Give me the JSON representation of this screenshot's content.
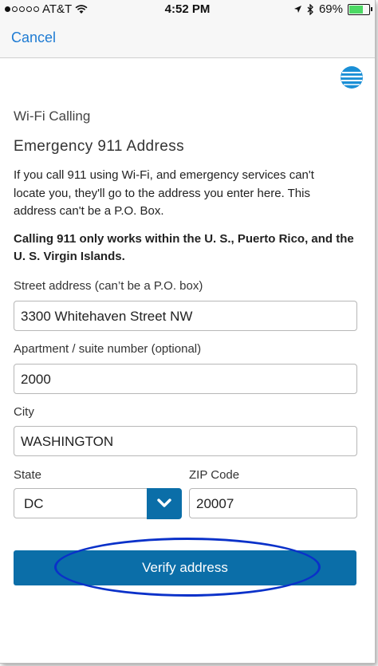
{
  "status": {
    "carrier": "AT&T",
    "time": "4:52 PM",
    "battery": "69%",
    "battery_level": 0.69,
    "signal_bars_filled": 1,
    "signal_bars_total": 5
  },
  "nav": {
    "cancel_label": "Cancel"
  },
  "header": {
    "section": "Wi-Fi Calling",
    "title": "Emergency 911 Address"
  },
  "description": "If you call 911 using Wi-Fi, and emergency services can't locate you, they'll go to the address you enter here. This address can't be a P.O. Box.",
  "notice": "Calling 911 only works within the U. S., Puerto Rico, and the U. S. Virgin Islands.",
  "form": {
    "street_label": "Street address (can’t be a P.O. box)",
    "street_value": "3300 Whitehaven Street NW",
    "apt_label": "Apartment / suite number (optional)",
    "apt_value": "2000",
    "city_label": "City",
    "city_value": "WASHINGTON",
    "state_label": "State",
    "state_value": "DC",
    "zip_label": "ZIP Code",
    "zip_value": "20007"
  },
  "verify_label": "Verify address",
  "colors": {
    "accent": "#0b6ea8",
    "link": "#1e7bd3",
    "annotation_ring": "#0a31c9",
    "battery_fill": "#4cd964"
  },
  "icons": {
    "wifi": "wifi-icon",
    "location": "location-arrow-icon",
    "bluetooth": "bluetooth-icon",
    "battery": "battery-icon",
    "logo": "att-globe-logo",
    "dropdown": "chevron-down-icon"
  }
}
